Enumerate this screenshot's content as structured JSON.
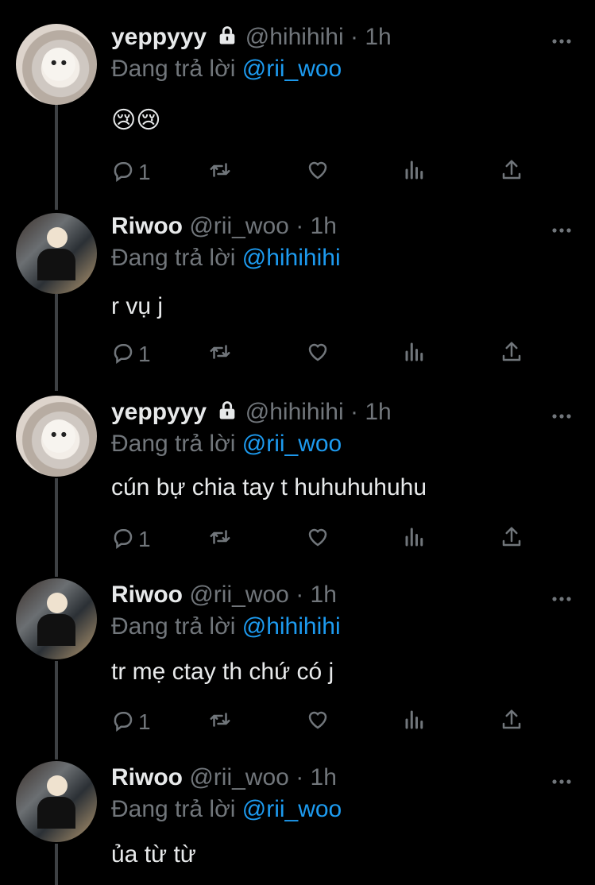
{
  "tweets": [
    {
      "name": "yeppyyy",
      "handle": "@hihihihi",
      "time": "1h",
      "replying_prefix": "Đang trả lời",
      "replying_to": "@rii_woo",
      "text": "😢😢",
      "reply_count": "1"
    },
    {
      "name": "Riwoo",
      "handle": "@rii_woo",
      "time": "1h",
      "replying_prefix": "Đang trả lời",
      "replying_to": "@hihihihi",
      "text": "r vụ j",
      "reply_count": "1"
    },
    {
      "name": "yeppyyy",
      "handle": "@hihihihi",
      "time": "1h",
      "replying_prefix": "Đang trả lời",
      "replying_to": "@rii_woo",
      "text": "cún bự chia tay t huhuhuhuhu",
      "reply_count": "1"
    },
    {
      "name": "Riwoo",
      "handle": "@rii_woo",
      "time": "1h",
      "replying_prefix": "Đang trả lời",
      "replying_to": "@hihihihi",
      "text": "tr mẹ ctay th chứ có j",
      "reply_count": "1"
    },
    {
      "name": "Riwoo",
      "handle": "@rii_woo",
      "time": "1h",
      "replying_prefix": "Đang trả lời",
      "replying_to": "@rii_woo",
      "text": "ủa từ từ",
      "reply_count": ""
    }
  ],
  "icons": {
    "reply": "reply-icon",
    "retweet": "retweet-icon",
    "like": "heart-icon",
    "views": "analytics-icon",
    "share": "share-icon",
    "more": "more-icon",
    "lock": "lock-icon"
  },
  "colors": {
    "background": "#000000",
    "text": "#e7e9ea",
    "secondary": "#71767b",
    "mention": "#1d9bf0",
    "thread_line": "#3e4144"
  }
}
